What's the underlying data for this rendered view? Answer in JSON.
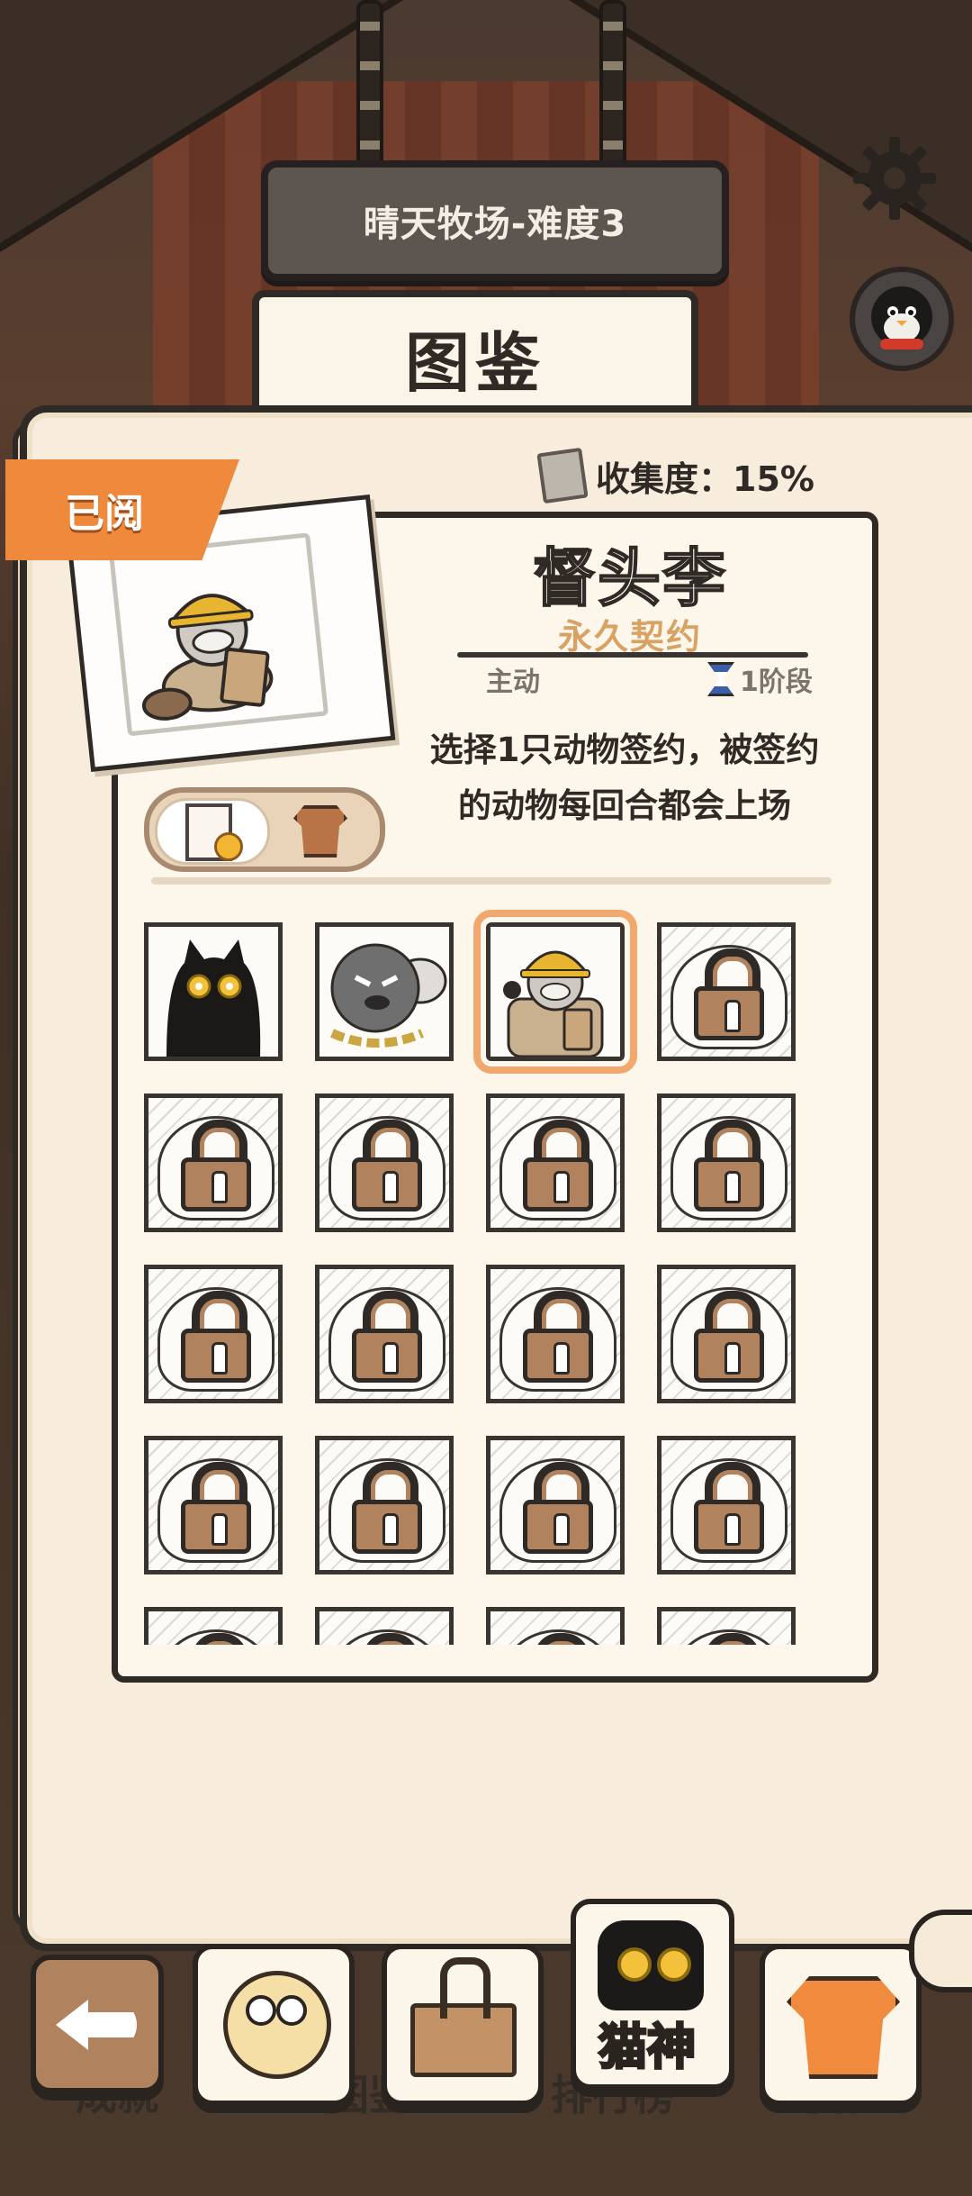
{
  "header": {
    "level_sign": "晴天牧场-难度3",
    "title": "图鉴"
  },
  "collection": {
    "label": "收集度：15%"
  },
  "tabs": {
    "read_label": "已阅"
  },
  "character": {
    "name": "督头李",
    "contract": "永久契约",
    "type": "主动",
    "stage": "1阶段",
    "description_line1": "选择1只动物签约，被签约",
    "description_line2": "的动物每回合都会上场"
  },
  "grid": {
    "cells": [
      {
        "state": "unlocked",
        "animal": "black-cat"
      },
      {
        "state": "unlocked",
        "animal": "chained-bear"
      },
      {
        "state": "unlocked",
        "animal": "foreman-lee",
        "selected": true
      },
      {
        "state": "locked"
      },
      {
        "state": "locked"
      },
      {
        "state": "locked"
      },
      {
        "state": "locked"
      },
      {
        "state": "locked"
      },
      {
        "state": "locked"
      },
      {
        "state": "locked"
      },
      {
        "state": "locked"
      },
      {
        "state": "locked"
      },
      {
        "state": "locked"
      },
      {
        "state": "locked"
      },
      {
        "state": "locked"
      },
      {
        "state": "locked"
      },
      {
        "state": "locked"
      },
      {
        "state": "locked"
      },
      {
        "state": "locked"
      },
      {
        "state": "locked"
      }
    ]
  },
  "footer": {
    "achievements_label": "成就",
    "dex_label": "图鉴",
    "cat_god_label": "猫神",
    "leaderboard_label": "排行榜",
    "shop_label": "商店"
  },
  "colors": {
    "accent_orange": "#ef8a3c",
    "lock_brown": "#b0835e",
    "paper": "#f8ecdc"
  }
}
